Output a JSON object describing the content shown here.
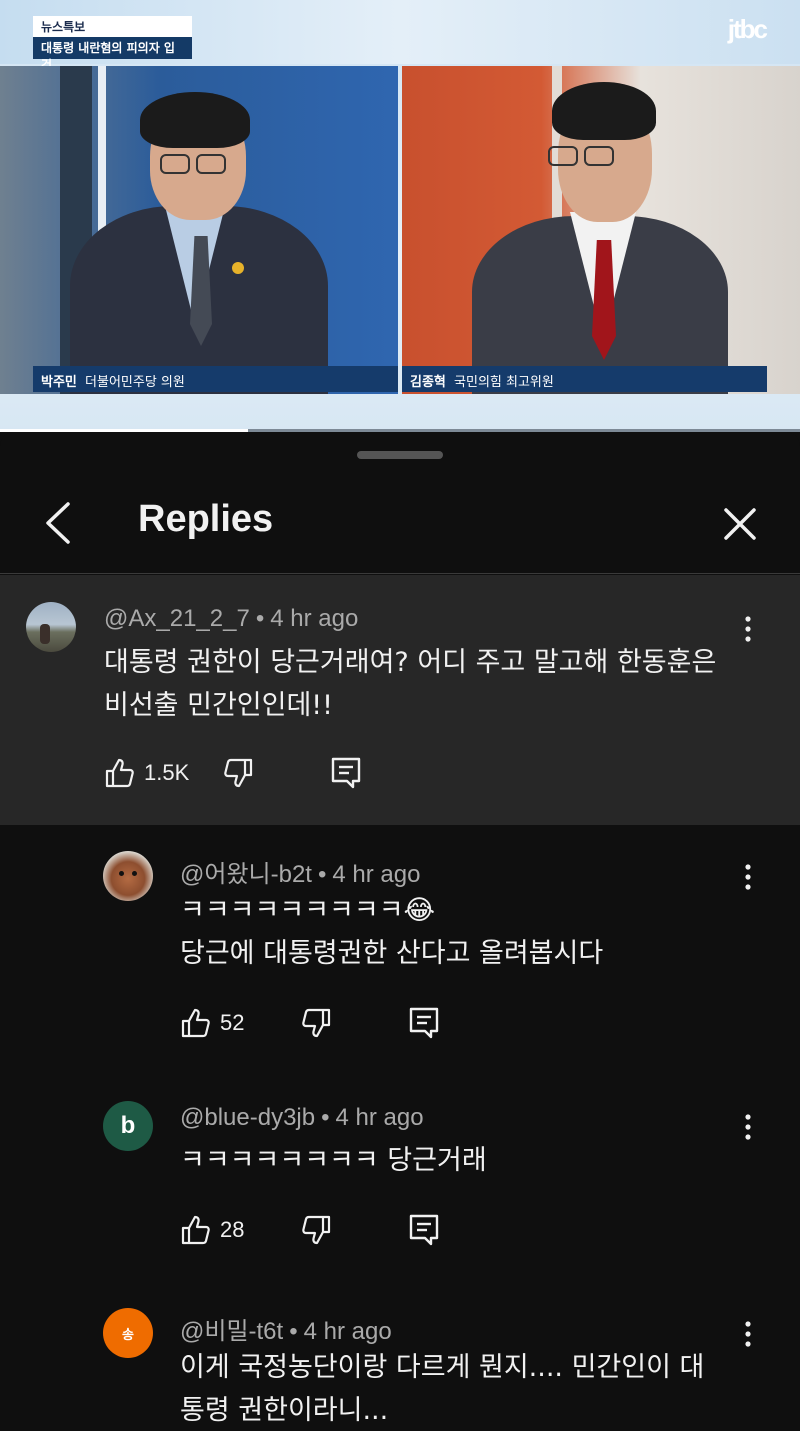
{
  "video": {
    "tag": "뉴스특보",
    "headline": "대통령 내란혐의 피의자 입건",
    "channel_logo": "jtbc",
    "left_guest": {
      "name": "박주민",
      "role": "더불어민주당 의원"
    },
    "right_guest": {
      "name": "김종혁",
      "role": "국민의힘 최고위원"
    },
    "progress": 0.31
  },
  "header": {
    "title": "Replies",
    "back_icon": "chevron-left-icon",
    "close_icon": "close-icon"
  },
  "parent_comment": {
    "author": "@Ax_21_2_7",
    "time": "4 hr ago",
    "text_lines": [
      "대통령 권한이 당근거래여? 어디 주고 말고해 한동훈은",
      "비선출 민간인인데!!"
    ],
    "likes": "1.5K"
  },
  "replies": [
    {
      "author": "@어왔니-b2t",
      "time": "4 hr ago",
      "text_lines": [
        "ㅋㅋㅋㅋㅋㅋㅋㅋㅋ😂",
        "당근에 대통령권한 산다고 올려봅시다"
      ],
      "likes": "52",
      "avatar_type": "photo"
    },
    {
      "author": "@blue-dy3jb",
      "time": "4 hr ago",
      "text_lines": [
        "ㅋㅋㅋㅋㅋㅋㅋㅋ 당근거래"
      ],
      "likes": "28",
      "avatar_letter": "b",
      "avatar_color": "#1e5a45"
    },
    {
      "author": "@비밀-t6t",
      "time": "4 hr ago",
      "text_lines": [
        "이게 국정농단이랑 다르게 뭔지.... 민간인이 대",
        "통령 권한이라니..."
      ],
      "avatar_letter": "송",
      "avatar_color": "#ef6c00"
    }
  ]
}
